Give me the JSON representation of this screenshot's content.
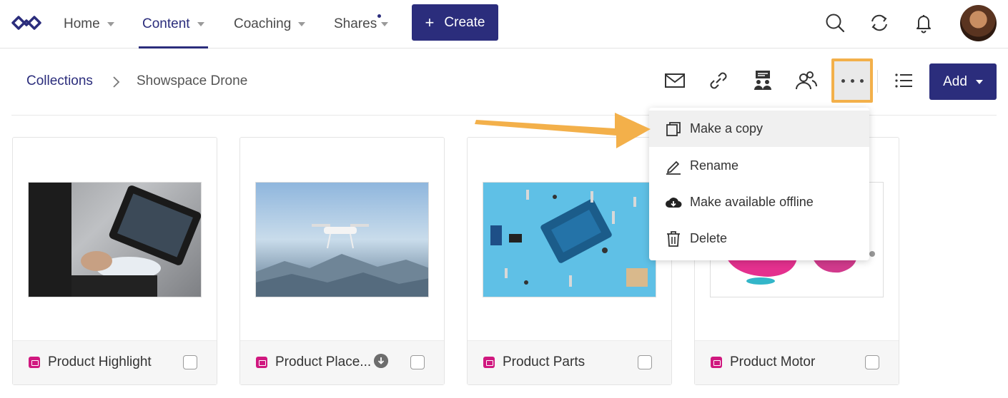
{
  "nav": {
    "items": [
      {
        "label": "Home"
      },
      {
        "label": "Content"
      },
      {
        "label": "Coaching"
      },
      {
        "label": "Shares"
      }
    ],
    "create_label": "Create"
  },
  "breadcrumb": {
    "root": "Collections",
    "current": "Showspace Drone"
  },
  "toolbar": {
    "add_label": "Add"
  },
  "menu": {
    "items": [
      {
        "label": "Make a copy",
        "icon": "copy-icon"
      },
      {
        "label": "Rename",
        "icon": "pencil-icon"
      },
      {
        "label": "Make available offline",
        "icon": "cloud-download-icon"
      },
      {
        "label": "Delete",
        "icon": "trash-icon"
      }
    ]
  },
  "cards": [
    {
      "title": "Product Highlight"
    },
    {
      "title": "Product Place..."
    },
    {
      "title": "Product Parts"
    },
    {
      "title": "Product Motor"
    }
  ],
  "colors": {
    "brand": "#2b2d7c",
    "highlight": "#f3b04a",
    "type_icon": "#d0187f"
  }
}
